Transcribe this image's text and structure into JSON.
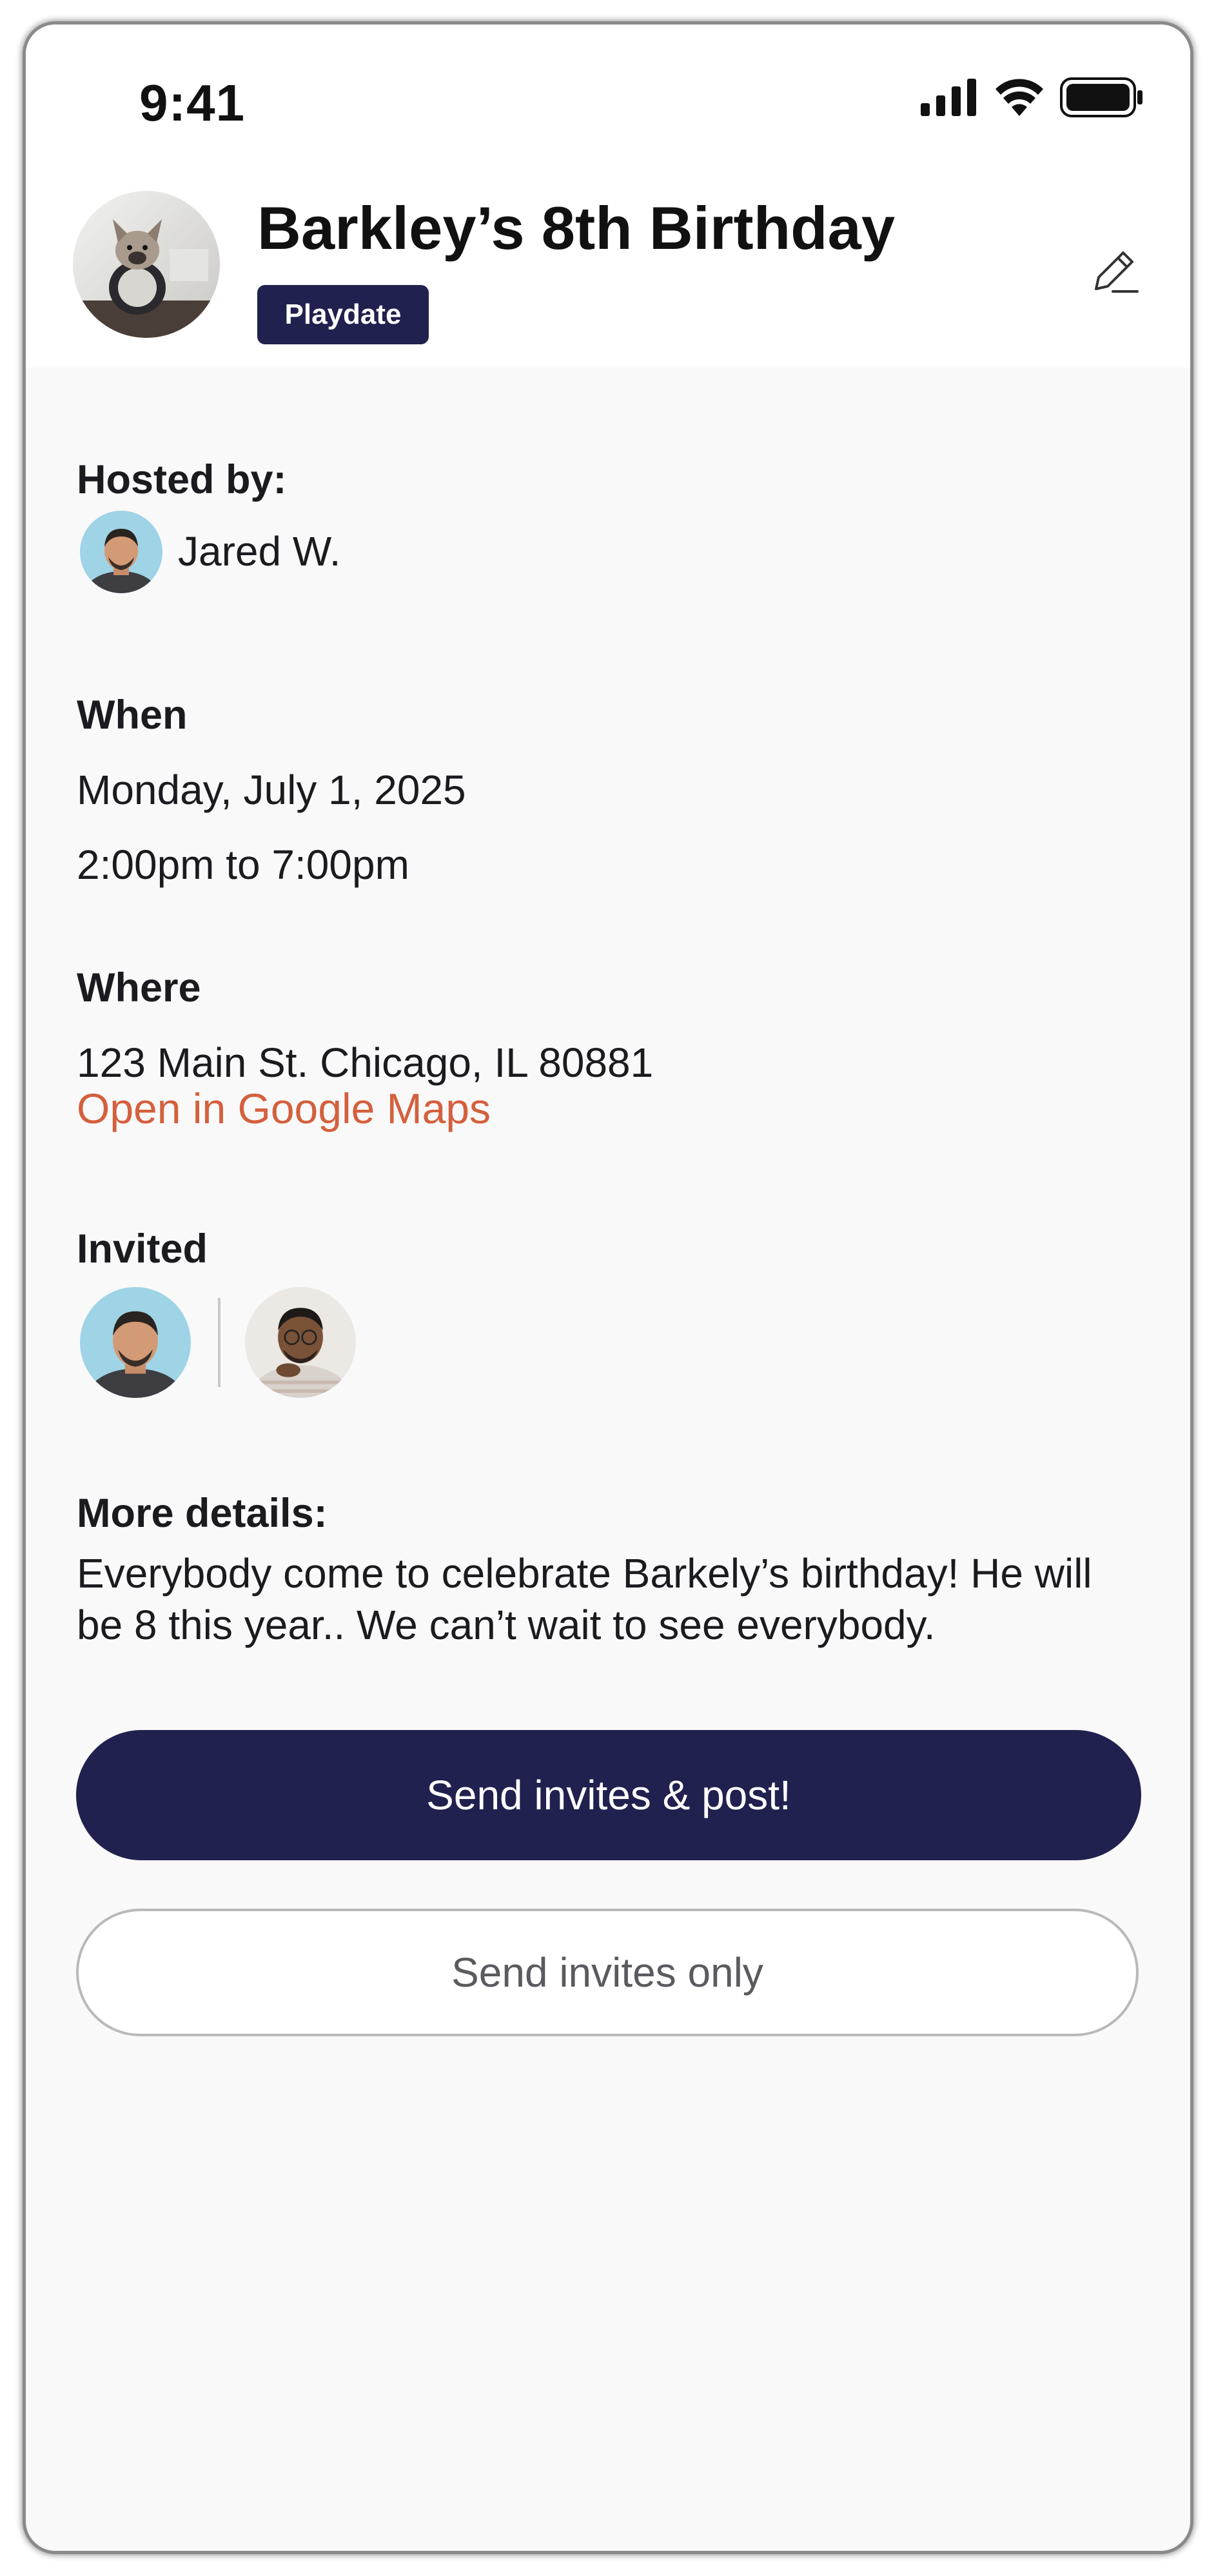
{
  "status_bar": {
    "time": "9:41",
    "icons": [
      "cellular-signal-icon",
      "wifi-icon",
      "battery-icon"
    ]
  },
  "event": {
    "title": "Barkley’s 8th Birthday",
    "category_badge": "Playdate",
    "avatar": "dog-photo"
  },
  "host": {
    "label": "Hosted by:",
    "name": "Jared W."
  },
  "when": {
    "label": "When",
    "date": "Monday, July 1, 2025",
    "time_range": "2:00pm to 7:00pm"
  },
  "where": {
    "label": "Where",
    "address": "123 Main St. Chicago, IL 80881",
    "maps_link": "Open in Google Maps"
  },
  "invited": {
    "label": "Invited",
    "people": [
      "person-avatar-1",
      "person-avatar-2"
    ]
  },
  "details": {
    "label": "More details:",
    "text": "Everybody come to celebrate Barkely’s birthday! He will be 8 this year.. We can’t wait to see everybody."
  },
  "actions": {
    "primary_label": "Send invites & post!",
    "secondary_label": "Send invites only"
  },
  "colors": {
    "navy": "#21214f",
    "link_orange": "#d4603d",
    "background": "#f9f9f9"
  }
}
